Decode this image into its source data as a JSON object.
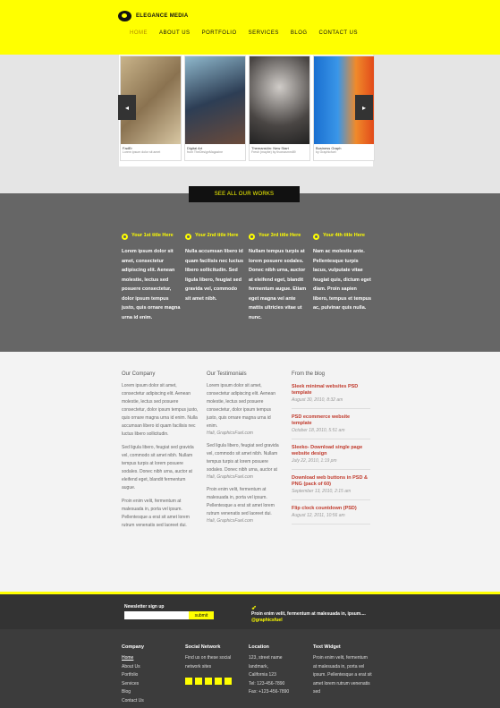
{
  "header": {
    "brand": "ELEGANCE MEDIA",
    "nav": [
      "HOME",
      "ABOUT US",
      "PORTFOLIO",
      "SERVICES",
      "BLOG",
      "CONTACT US"
    ]
  },
  "slider": {
    "prev": "◂",
    "next": "▸",
    "slides": [
      {
        "title": "FadEr",
        "sub": "Lorem ipsum dolor sit amet"
      },
      {
        "title": "Digital Art",
        "sub": "from TheDesignMagazine"
      },
      {
        "title": "Themansiön: New Start",
        "sub": "Fresh (maybe) by thomasmm89"
      },
      {
        "title": "Business Graph",
        "sub": "by Graphicfuel"
      }
    ]
  },
  "works_button": "SEE ALL OUR WORKS",
  "features": [
    {
      "title": "Your 1st title Here",
      "text": "Lorem ipsum dolor sit amet, consectetur adipiscing elit. Aenean molestie, lectus sed posuere consectetur, dolor ipsum tempus justo, quis ornare magna urna id enim."
    },
    {
      "title": "Your 2nd title Here",
      "text": "Nulla accumsan libero id quam facilisis nec luctus libero sollicitudin. Sed ligula libero, feugiat sed gravida vel, commodo sit amet nibh."
    },
    {
      "title": "Your 3rd title Here",
      "text": "Nullam tempus turpis at lorem posuere sodales. Donec nibh urna, auctor at eleifend eget, blandit fermentum augue. Etiam eget magna vel ante mattis ultricies vitae ut nunc."
    },
    {
      "title": "Your 4th title Here",
      "text": "Nam ac molestie ante. Pellentesque turpis lacus, vulputate vitae feugiat quis, dictum eget diam. Proin sapien libero, tempus et tempus ac, pulvinar quis nulla."
    }
  ],
  "company": {
    "heading": "Our Company",
    "p1": "Lorem ipsum dolor sit amet, consectetur adipiscing elit. Aenean molestie, lectus sed posuere consectetur, dolor ipsum tempus justo, quis ornare magna urna id enim. Nulla accumsan libero id quam facilisis nec luctus libero sollicitudin.",
    "p2": "Sed ligula libero, feugiat sed gravida vel, commodo sit amet nibh. Nullam tempus turpis at lorem posuere sodales. Donec nibh urna, auctor at eleifend eget, blandit fermentum augue.",
    "p3": "Proin enim velit, fermentum at malesuada in, porta vel ipsum. Pellentesque a erat sit amet lorem rutrum venenatis sed laoreet dui."
  },
  "testimonials": {
    "heading": "Our Testimonials",
    "items": [
      {
        "text": "Lorem ipsum dolor sit amet, consectetur adipiscing elit. Aenean molestie, lectus sed posuere consectetur, dolor ipsum tempus justo, quis ornare magna urna id enim.",
        "author": "Hali, GraphicsFuel.com"
      },
      {
        "text": "Sed ligula libero, feugiat sed gravida vel, commodo sit amet nibh. Nullam tempus turpis at lorem posuere sodales. Donec nibh urna, auctor at",
        "author": "Hali, GraphicsFuel.com"
      },
      {
        "text": "Proin enim velit, fermentum at malesuada in, porta vel ipsum. Pellentesque a erat sit amet lorem rutrum venenatis sed laoreet dui.",
        "author": "Hali, GraphicsFuel.com"
      }
    ]
  },
  "blog": {
    "heading": "From the blog",
    "items": [
      {
        "title": "Sleek minimal websites PSD template",
        "date": "August 30, 2010, 8:32 am"
      },
      {
        "title": "PSD ecommerce website template",
        "date": "October 18, 2010, 5:51 am"
      },
      {
        "title": "Sleeko- Download single page website design",
        "date": "July 22, 2010, 1:19 pm"
      },
      {
        "title": "Download web buttons in PSD & PNG (pack of 60)",
        "date": "September 13, 2010, 2:15 am"
      },
      {
        "title": "Flip clock countdown (PSD)",
        "date": "August 12, 2011, 10:56 am"
      }
    ]
  },
  "newsletter": {
    "label": "Newsletter sign up",
    "button": "submit",
    "tweet": "Proin enim velit, fermentum at malesuada in, ipsum....",
    "tweet_handle": "@graphicsfuel"
  },
  "footer": {
    "company": {
      "heading": "Company",
      "links": [
        "Home",
        "About Us",
        "Portfolio",
        "Services",
        "Blog",
        "Contact Us"
      ]
    },
    "social": {
      "heading": "Social Network",
      "text": "Find us on these social network sites"
    },
    "location": {
      "heading": "Location",
      "lines": [
        "123, street name",
        "landmark,",
        "California 123",
        "Tel: 123-456-7890",
        "Fax: +123-456-7890"
      ]
    },
    "widget": {
      "heading": "Text Widget",
      "text": "Proin enim velit, fermentum at malesuada in, porta vel ipsum. Pellentesque a erat sit amet lorem rutrum venenatis sed"
    }
  }
}
